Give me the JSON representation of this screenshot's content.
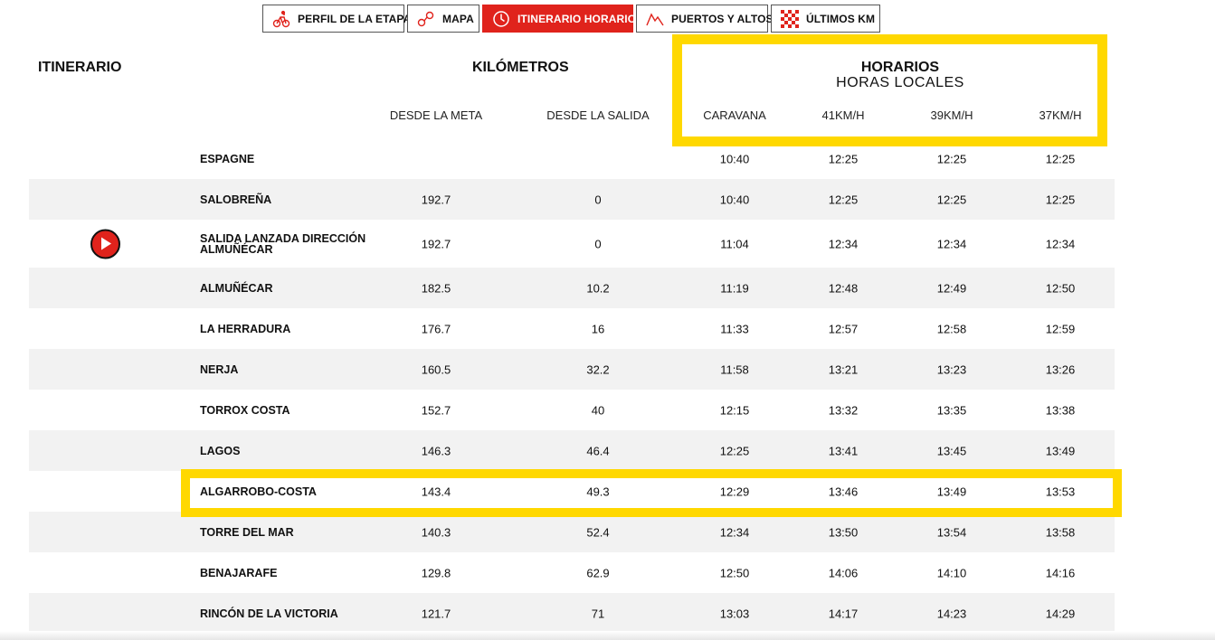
{
  "tabs": [
    {
      "label": "PERFIL DE LA ETAPA",
      "icon": "cyclist-icon"
    },
    {
      "label": "MAPA",
      "icon": "route-map-icon"
    },
    {
      "label": "ITINERARIO HORARIO",
      "icon": "clock-icon"
    },
    {
      "label": "PUERTOS Y ALTOS",
      "icon": "mountain-icon"
    },
    {
      "label": "ÚLTIMOS KM",
      "icon": "checkered-flag-icon"
    }
  ],
  "headers": {
    "itinerario": "ITINERARIO",
    "kilometros": "KILÓMETROS",
    "horarios": "HORARIOS",
    "horarios_sub": "HORAS LOCALES",
    "cols": {
      "desde_meta": "DESDE LA META",
      "desde_salida": "DESDE LA SALIDA",
      "caravana": "CARAVANA",
      "s41": "41KM/H",
      "s39": "39KM/H",
      "s37": "37KM/H"
    }
  },
  "colors": {
    "accent": "#e0231c",
    "highlight": "#ffd800"
  },
  "rows": [
    {
      "name": "ESPAGNE",
      "meta": "",
      "salida": "",
      "caravana": "10:40",
      "s41": "12:25",
      "s39": "12:25",
      "s37": "12:25"
    },
    {
      "name": "SALOBREÑA",
      "meta": "192.7",
      "salida": "0",
      "caravana": "10:40",
      "s41": "12:25",
      "s39": "12:25",
      "s37": "12:25"
    },
    {
      "name": "SALIDA LANZADA DIRECCIÓN ALMUÑÉCAR",
      "meta": "192.7",
      "salida": "0",
      "caravana": "11:04",
      "s41": "12:34",
      "s39": "12:34",
      "s37": "12:34",
      "icon": "play-icon"
    },
    {
      "name": "ALMUÑÉCAR",
      "meta": "182.5",
      "salida": "10.2",
      "caravana": "11:19",
      "s41": "12:48",
      "s39": "12:49",
      "s37": "12:50"
    },
    {
      "name": "LA HERRADURA",
      "meta": "176.7",
      "salida": "16",
      "caravana": "11:33",
      "s41": "12:57",
      "s39": "12:58",
      "s37": "12:59"
    },
    {
      "name": "NERJA",
      "meta": "160.5",
      "salida": "32.2",
      "caravana": "11:58",
      "s41": "13:21",
      "s39": "13:23",
      "s37": "13:26"
    },
    {
      "name": "TORROX COSTA",
      "meta": "152.7",
      "salida": "40",
      "caravana": "12:15",
      "s41": "13:32",
      "s39": "13:35",
      "s37": "13:38"
    },
    {
      "name": "LAGOS",
      "meta": "146.3",
      "salida": "46.4",
      "caravana": "12:25",
      "s41": "13:41",
      "s39": "13:45",
      "s37": "13:49"
    },
    {
      "name": "ALGARROBO-COSTA",
      "meta": "143.4",
      "salida": "49.3",
      "caravana": "12:29",
      "s41": "13:46",
      "s39": "13:49",
      "s37": "13:53"
    },
    {
      "name": "TORRE DEL MAR",
      "meta": "140.3",
      "salida": "52.4",
      "caravana": "12:34",
      "s41": "13:50",
      "s39": "13:54",
      "s37": "13:58"
    },
    {
      "name": "BENAJARAFE",
      "meta": "129.8",
      "salida": "62.9",
      "caravana": "12:50",
      "s41": "14:06",
      "s39": "14:10",
      "s37": "14:16"
    },
    {
      "name": "RINCÓN DE LA VICTORIA",
      "meta": "121.7",
      "salida": "71",
      "caravana": "13:03",
      "s41": "14:17",
      "s39": "14:23",
      "s37": "14:29"
    }
  ]
}
